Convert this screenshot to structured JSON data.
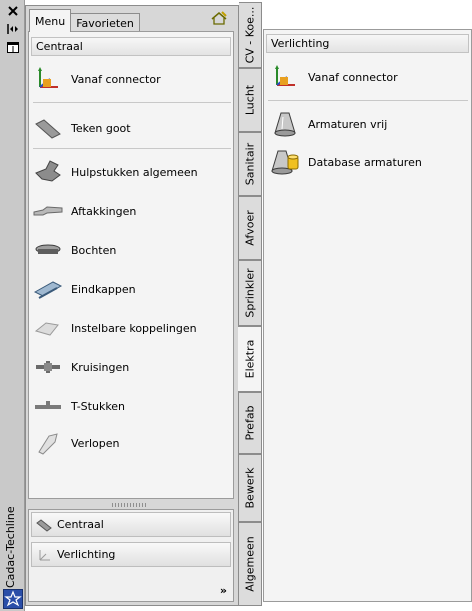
{
  "window": {
    "title": "Cadac-Techline"
  },
  "tabs": [
    {
      "label": "Menu"
    },
    {
      "label": "Favorieten"
    }
  ],
  "menu": {
    "section": "Centraal",
    "items": [
      {
        "label": "Vanaf connector"
      },
      {
        "label": "Teken goot"
      },
      {
        "label": "Hulpstukken algemeen"
      },
      {
        "label": "Aftakkingen"
      },
      {
        "label": "Bochten"
      },
      {
        "label": "Eindkappen"
      },
      {
        "label": "Instelbare koppelingen"
      },
      {
        "label": "Kruisingen"
      },
      {
        "label": "T-Stukken"
      },
      {
        "label": "Verlopen"
      }
    ]
  },
  "bottom": {
    "buttons": [
      {
        "label": "Centraal"
      },
      {
        "label": "Verlichting"
      }
    ],
    "more": "»"
  },
  "vertical_tabs": [
    {
      "label": "CV - Koe..."
    },
    {
      "label": "Lucht"
    },
    {
      "label": "Sanitair"
    },
    {
      "label": "Afvoer"
    },
    {
      "label": "Sprinkler"
    },
    {
      "label": "Elektra"
    },
    {
      "label": "Prefab"
    },
    {
      "label": "Bewerk"
    },
    {
      "label": "Algemeen"
    }
  ],
  "right_panel": {
    "section": "Verlichting",
    "items": [
      {
        "label": "Vanaf connector"
      },
      {
        "label": "Armaturen vrij"
      },
      {
        "label": "Database armaturen"
      }
    ]
  }
}
